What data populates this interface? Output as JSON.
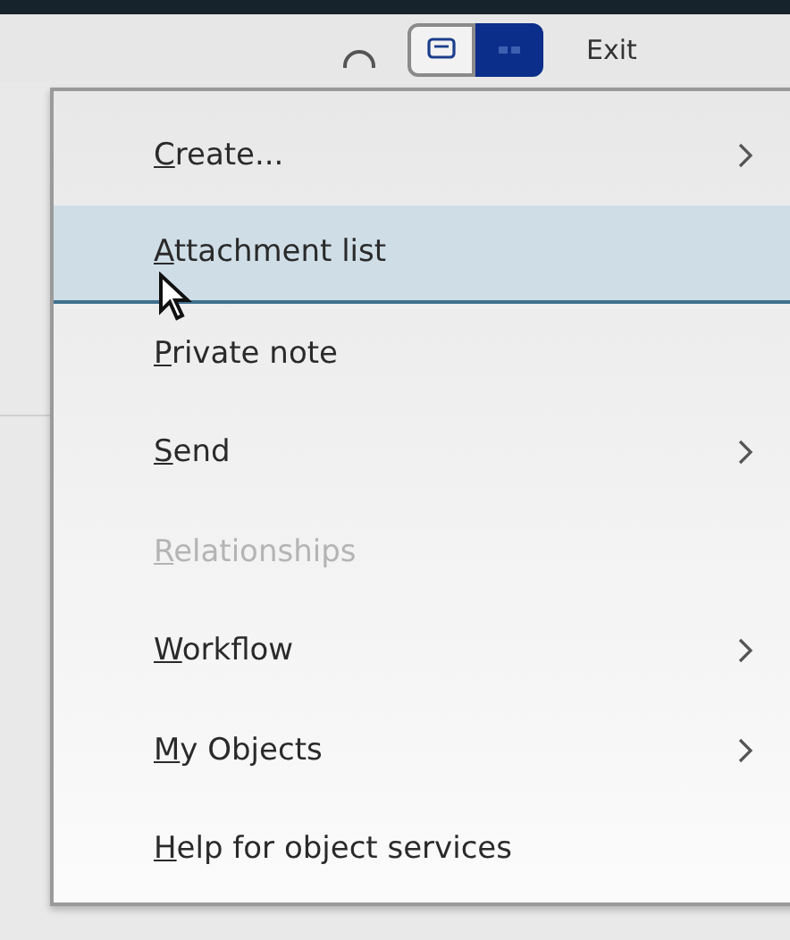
{
  "toolbar": {
    "view_toggle": [
      {
        "kind": "list",
        "selected": false
      },
      {
        "kind": "grid",
        "selected": true
      }
    ],
    "exit": "Exit"
  },
  "menu": {
    "items": [
      {
        "label": "Create...",
        "submenu": true,
        "disabled": false,
        "selected": false
      },
      {
        "label": "Attachment list",
        "submenu": false,
        "disabled": false,
        "selected": true
      },
      {
        "label": "Private note",
        "submenu": false,
        "disabled": false,
        "selected": false
      },
      {
        "label": "Send",
        "submenu": true,
        "disabled": false,
        "selected": false
      },
      {
        "label": "Relationships",
        "submenu": false,
        "disabled": true,
        "selected": false
      },
      {
        "label": "Workflow",
        "submenu": true,
        "disabled": false,
        "selected": false
      },
      {
        "label": "My Objects",
        "submenu": true,
        "disabled": false,
        "selected": false
      },
      {
        "label": "Help for object services",
        "submenu": false,
        "disabled": false,
        "selected": false
      }
    ]
  }
}
